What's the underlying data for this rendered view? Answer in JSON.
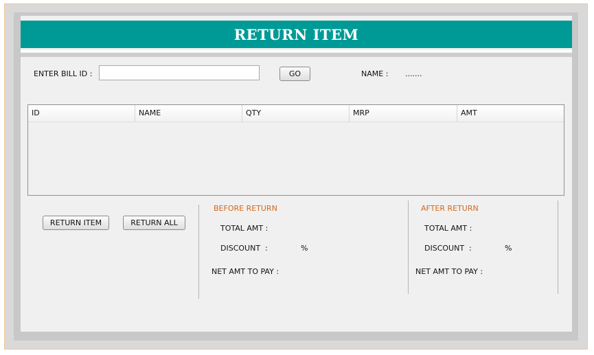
{
  "header": {
    "title": "RETURN ITEM"
  },
  "bill": {
    "label": "ENTER BILL ID :",
    "input_value": "",
    "go_label": "GO",
    "name_label": "NAME :",
    "name_value": "......."
  },
  "table": {
    "columns": [
      "ID",
      "NAME",
      "QTY",
      "MRP",
      "AMT"
    ],
    "rows": []
  },
  "actions": {
    "return_item_label": "RETURN ITEM",
    "return_all_label": "RETURN ALL"
  },
  "before": {
    "title": "BEFORE RETURN",
    "total_label": "TOTAL AMT :",
    "discount_label": "DISCOUNT  :",
    "percent": "%",
    "net_label": "NET AMT TO PAY :"
  },
  "after": {
    "title": "AFTER RETURN",
    "total_label": "TOTAL AMT :",
    "discount_label": "DISCOUNT  :",
    "percent": "%",
    "net_label": "NET AMT TO PAY :"
  },
  "colors": {
    "banner": "#009a96",
    "section_title": "#d2691e",
    "window_border": "#f3c48d"
  }
}
